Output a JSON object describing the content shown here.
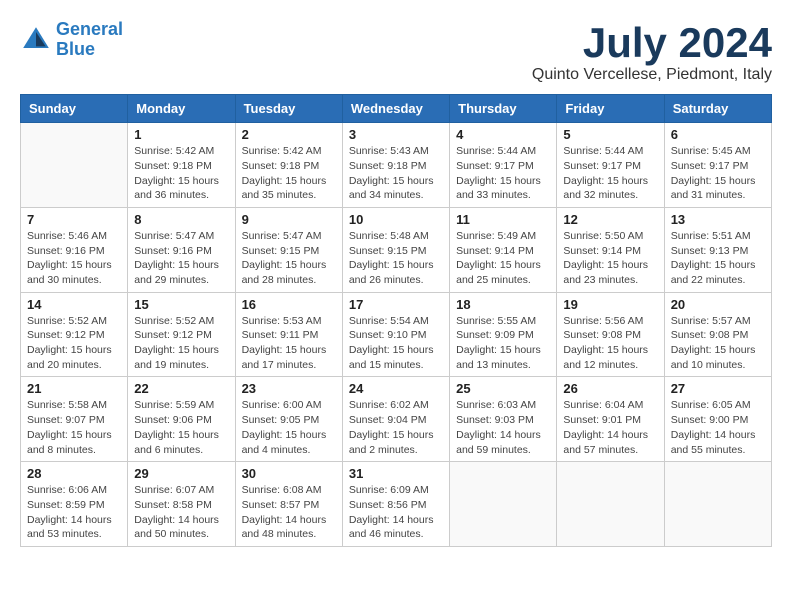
{
  "header": {
    "logo_line1": "General",
    "logo_line2": "Blue",
    "month_year": "July 2024",
    "location": "Quinto Vercellese, Piedmont, Italy"
  },
  "days_of_week": [
    "Sunday",
    "Monday",
    "Tuesday",
    "Wednesday",
    "Thursday",
    "Friday",
    "Saturday"
  ],
  "weeks": [
    [
      {
        "day": "",
        "info": ""
      },
      {
        "day": "1",
        "info": "Sunrise: 5:42 AM\nSunset: 9:18 PM\nDaylight: 15 hours\nand 36 minutes."
      },
      {
        "day": "2",
        "info": "Sunrise: 5:42 AM\nSunset: 9:18 PM\nDaylight: 15 hours\nand 35 minutes."
      },
      {
        "day": "3",
        "info": "Sunrise: 5:43 AM\nSunset: 9:18 PM\nDaylight: 15 hours\nand 34 minutes."
      },
      {
        "day": "4",
        "info": "Sunrise: 5:44 AM\nSunset: 9:17 PM\nDaylight: 15 hours\nand 33 minutes."
      },
      {
        "day": "5",
        "info": "Sunrise: 5:44 AM\nSunset: 9:17 PM\nDaylight: 15 hours\nand 32 minutes."
      },
      {
        "day": "6",
        "info": "Sunrise: 5:45 AM\nSunset: 9:17 PM\nDaylight: 15 hours\nand 31 minutes."
      }
    ],
    [
      {
        "day": "7",
        "info": "Sunrise: 5:46 AM\nSunset: 9:16 PM\nDaylight: 15 hours\nand 30 minutes."
      },
      {
        "day": "8",
        "info": "Sunrise: 5:47 AM\nSunset: 9:16 PM\nDaylight: 15 hours\nand 29 minutes."
      },
      {
        "day": "9",
        "info": "Sunrise: 5:47 AM\nSunset: 9:15 PM\nDaylight: 15 hours\nand 28 minutes."
      },
      {
        "day": "10",
        "info": "Sunrise: 5:48 AM\nSunset: 9:15 PM\nDaylight: 15 hours\nand 26 minutes."
      },
      {
        "day": "11",
        "info": "Sunrise: 5:49 AM\nSunset: 9:14 PM\nDaylight: 15 hours\nand 25 minutes."
      },
      {
        "day": "12",
        "info": "Sunrise: 5:50 AM\nSunset: 9:14 PM\nDaylight: 15 hours\nand 23 minutes."
      },
      {
        "day": "13",
        "info": "Sunrise: 5:51 AM\nSunset: 9:13 PM\nDaylight: 15 hours\nand 22 minutes."
      }
    ],
    [
      {
        "day": "14",
        "info": "Sunrise: 5:52 AM\nSunset: 9:12 PM\nDaylight: 15 hours\nand 20 minutes."
      },
      {
        "day": "15",
        "info": "Sunrise: 5:52 AM\nSunset: 9:12 PM\nDaylight: 15 hours\nand 19 minutes."
      },
      {
        "day": "16",
        "info": "Sunrise: 5:53 AM\nSunset: 9:11 PM\nDaylight: 15 hours\nand 17 minutes."
      },
      {
        "day": "17",
        "info": "Sunrise: 5:54 AM\nSunset: 9:10 PM\nDaylight: 15 hours\nand 15 minutes."
      },
      {
        "day": "18",
        "info": "Sunrise: 5:55 AM\nSunset: 9:09 PM\nDaylight: 15 hours\nand 13 minutes."
      },
      {
        "day": "19",
        "info": "Sunrise: 5:56 AM\nSunset: 9:08 PM\nDaylight: 15 hours\nand 12 minutes."
      },
      {
        "day": "20",
        "info": "Sunrise: 5:57 AM\nSunset: 9:08 PM\nDaylight: 15 hours\nand 10 minutes."
      }
    ],
    [
      {
        "day": "21",
        "info": "Sunrise: 5:58 AM\nSunset: 9:07 PM\nDaylight: 15 hours\nand 8 minutes."
      },
      {
        "day": "22",
        "info": "Sunrise: 5:59 AM\nSunset: 9:06 PM\nDaylight: 15 hours\nand 6 minutes."
      },
      {
        "day": "23",
        "info": "Sunrise: 6:00 AM\nSunset: 9:05 PM\nDaylight: 15 hours\nand 4 minutes."
      },
      {
        "day": "24",
        "info": "Sunrise: 6:02 AM\nSunset: 9:04 PM\nDaylight: 15 hours\nand 2 minutes."
      },
      {
        "day": "25",
        "info": "Sunrise: 6:03 AM\nSunset: 9:03 PM\nDaylight: 14 hours\nand 59 minutes."
      },
      {
        "day": "26",
        "info": "Sunrise: 6:04 AM\nSunset: 9:01 PM\nDaylight: 14 hours\nand 57 minutes."
      },
      {
        "day": "27",
        "info": "Sunrise: 6:05 AM\nSunset: 9:00 PM\nDaylight: 14 hours\nand 55 minutes."
      }
    ],
    [
      {
        "day": "28",
        "info": "Sunrise: 6:06 AM\nSunset: 8:59 PM\nDaylight: 14 hours\nand 53 minutes."
      },
      {
        "day": "29",
        "info": "Sunrise: 6:07 AM\nSunset: 8:58 PM\nDaylight: 14 hours\nand 50 minutes."
      },
      {
        "day": "30",
        "info": "Sunrise: 6:08 AM\nSunset: 8:57 PM\nDaylight: 14 hours\nand 48 minutes."
      },
      {
        "day": "31",
        "info": "Sunrise: 6:09 AM\nSunset: 8:56 PM\nDaylight: 14 hours\nand 46 minutes."
      },
      {
        "day": "",
        "info": ""
      },
      {
        "day": "",
        "info": ""
      },
      {
        "day": "",
        "info": ""
      }
    ]
  ]
}
